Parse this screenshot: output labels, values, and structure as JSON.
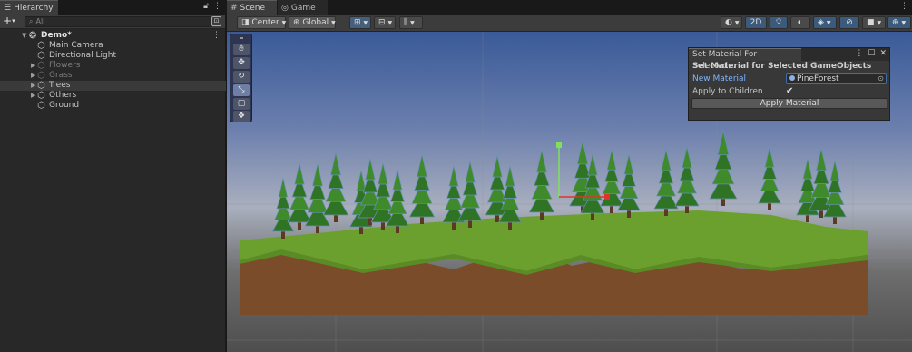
{
  "hierarchy": {
    "tab_label": "Hierarchy",
    "tab_icon": "list-icon",
    "search_placeholder": "All",
    "add_label": "+",
    "scene_name": "Demo*",
    "items": [
      {
        "label": "Main Camera",
        "dimmed": false,
        "expandable": false,
        "selected": false
      },
      {
        "label": "Directional Light",
        "dimmed": false,
        "expandable": false,
        "selected": false
      },
      {
        "label": "Flowers",
        "dimmed": true,
        "expandable": true,
        "selected": false
      },
      {
        "label": "Grass",
        "dimmed": true,
        "expandable": true,
        "selected": false
      },
      {
        "label": "Trees",
        "dimmed": false,
        "expandable": true,
        "selected": true
      },
      {
        "label": "Others",
        "dimmed": false,
        "expandable": true,
        "selected": false
      },
      {
        "label": "Ground",
        "dimmed": false,
        "expandable": false,
        "selected": false
      }
    ]
  },
  "scene": {
    "tabs": [
      {
        "label": "Scene",
        "icon": "grid-icon",
        "active": true
      },
      {
        "label": "Game",
        "icon": "gamepad-icon",
        "active": false
      }
    ],
    "toolbar": {
      "pivot_label": "Center",
      "space_label": "Global",
      "mode_2d_label": "2D"
    },
    "tools": [
      "hand-tool",
      "move-tool",
      "rotate-tool",
      "scale-tool",
      "rect-tool",
      "transform-tool"
    ],
    "active_tool": "scale-tool"
  },
  "material_window": {
    "tab_title": "Set Material For Selected...",
    "heading": "Set Material for Selected GameObjects",
    "new_material_label": "New Material",
    "new_material_value": "PineForest",
    "apply_children_label": "Apply to Children",
    "apply_children_checked": true,
    "apply_button_label": "Apply Material"
  },
  "colors": {
    "accent_blue": "#7fb5ff",
    "panel_bg": "#282828",
    "toolbar_bg": "#3c3c3c",
    "grass": "#6ba02e",
    "dirt": "#7a4c2a"
  }
}
